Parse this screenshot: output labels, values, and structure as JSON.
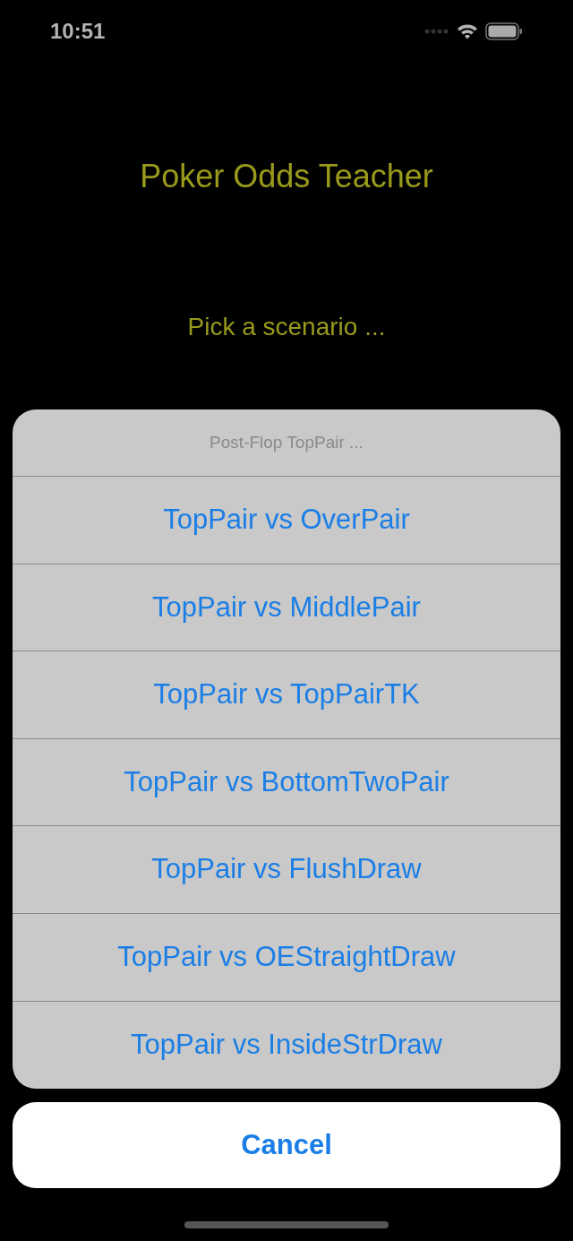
{
  "status_bar": {
    "time": "10:51"
  },
  "title": "Poker Odds Teacher",
  "prompt": "Pick a scenario ...",
  "action_sheet": {
    "title": "Post-Flop TopPair ...",
    "options": [
      "TopPair vs OverPair",
      "TopPair vs MiddlePair",
      "TopPair vs TopPairTK",
      "TopPair vs BottomTwoPair",
      "TopPair vs FlushDraw",
      "TopPair vs OEStraightDraw",
      "TopPair vs InsideStrDraw"
    ],
    "cancel": "Cancel"
  }
}
